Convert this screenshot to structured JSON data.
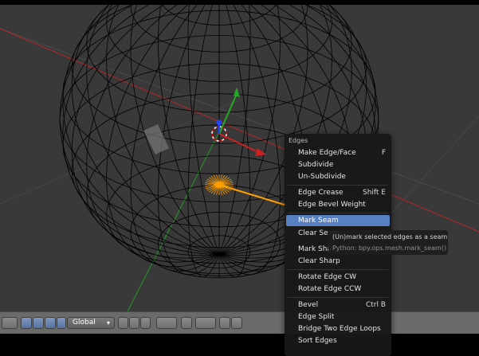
{
  "viewport": {
    "mesh": "uv-sphere-wireframe",
    "colors": {
      "background": "#393939",
      "wire": "#000000",
      "selected": "#ffa000",
      "x_axis": "#cc2222",
      "y_axis": "#22aa22",
      "z_axis": "#2244ff"
    }
  },
  "toolbar": {
    "orientation_label": "Global",
    "icons": [
      "mode-icon",
      "pivot-icon",
      "manipulator-icon",
      "translate-icon",
      "rotate-icon",
      "scale-icon",
      "vertex-select-icon",
      "edge-select-icon",
      "face-select-icon",
      "proportional-icon",
      "snap-icon",
      "render-icon"
    ]
  },
  "menu": {
    "title": "Edges",
    "items": [
      {
        "label": "Make Edge/Face",
        "shortcut": "F"
      },
      {
        "label": "Subdivide",
        "shortcut": ""
      },
      {
        "label": "Un-Subdivide",
        "shortcut": ""
      },
      {
        "label": "Edge Crease",
        "shortcut": "Shift E"
      },
      {
        "label": "Edge Bevel Weight",
        "shortcut": ""
      },
      {
        "label": "Mark Seam",
        "shortcut": ""
      },
      {
        "label": "Clear Seam",
        "shortcut": ""
      },
      {
        "label": "Mark Sharp",
        "shortcut": ""
      },
      {
        "label": "Clear Sharp",
        "shortcut": ""
      },
      {
        "label": "Rotate Edge CW",
        "shortcut": ""
      },
      {
        "label": "Rotate Edge CCW",
        "shortcut": ""
      },
      {
        "label": "Bevel",
        "shortcut": "Ctrl B"
      },
      {
        "label": "Edge Split",
        "shortcut": ""
      },
      {
        "label": "Bridge Two Edge Loops",
        "shortcut": ""
      },
      {
        "label": "Sort Edges",
        "shortcut": ""
      }
    ],
    "highlighted_index": 5,
    "highlight_color": "#5680c2"
  },
  "tooltip": {
    "text": "(Un)mark selected edges as a seam",
    "python": "Python: bpy.ops.mesh.mark_seam()"
  }
}
